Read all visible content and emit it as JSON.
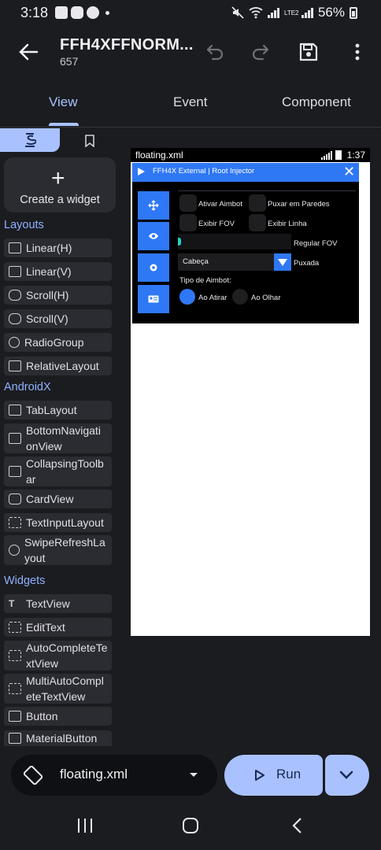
{
  "status_bar": {
    "time": "3:18",
    "battery": "56%",
    "network_label": "LTE2"
  },
  "app_bar": {
    "title": "FFH4XFFNORM...",
    "subtitle": "657"
  },
  "tabs": [
    "View",
    "Event",
    "Component"
  ],
  "palette": {
    "create_label": "Create a widget",
    "sections": {
      "layouts": "Layouts",
      "androidx": "AndroidX",
      "widgets": "Widgets"
    },
    "layouts": [
      "Linear(H)",
      "Linear(V)",
      "Scroll(H)",
      "Scroll(V)",
      "RadioGroup",
      "RelativeLayout"
    ],
    "androidx": [
      "TabLayout",
      "BottomNavigati\nonView",
      "CollapsingToolb\nar",
      "CardView",
      "TextInputLayout",
      "SwipeRefreshLa\nyout"
    ],
    "widgets": [
      "TextView",
      "EditText",
      "AutoCompleteTe\nxtView",
      "MultiAutoCompl\neteTextView",
      "Button",
      "MaterialButton"
    ]
  },
  "preview": {
    "file_name": "floating.xml",
    "time": "1:37",
    "panel_title": "FFH4X External | Root Injector",
    "checkboxes": [
      "Ativar Aimbot",
      "Puxar em Paredes",
      "Exibir FOV",
      "Exibir Linha"
    ],
    "slider_label": "Regular FOV",
    "slider_level": 0.02,
    "select_value": "Cabeça",
    "select_label": "Puxada",
    "aimbot_type_label": "Tipo de Aimbot:",
    "radio_options": [
      "Ao Atirar",
      "Ao Olhar"
    ],
    "radio_selected": "Ao Atirar",
    "accent_color": "#2f78f5"
  },
  "run_bar": {
    "file_name": "floating.xml",
    "run_label": "Run"
  }
}
